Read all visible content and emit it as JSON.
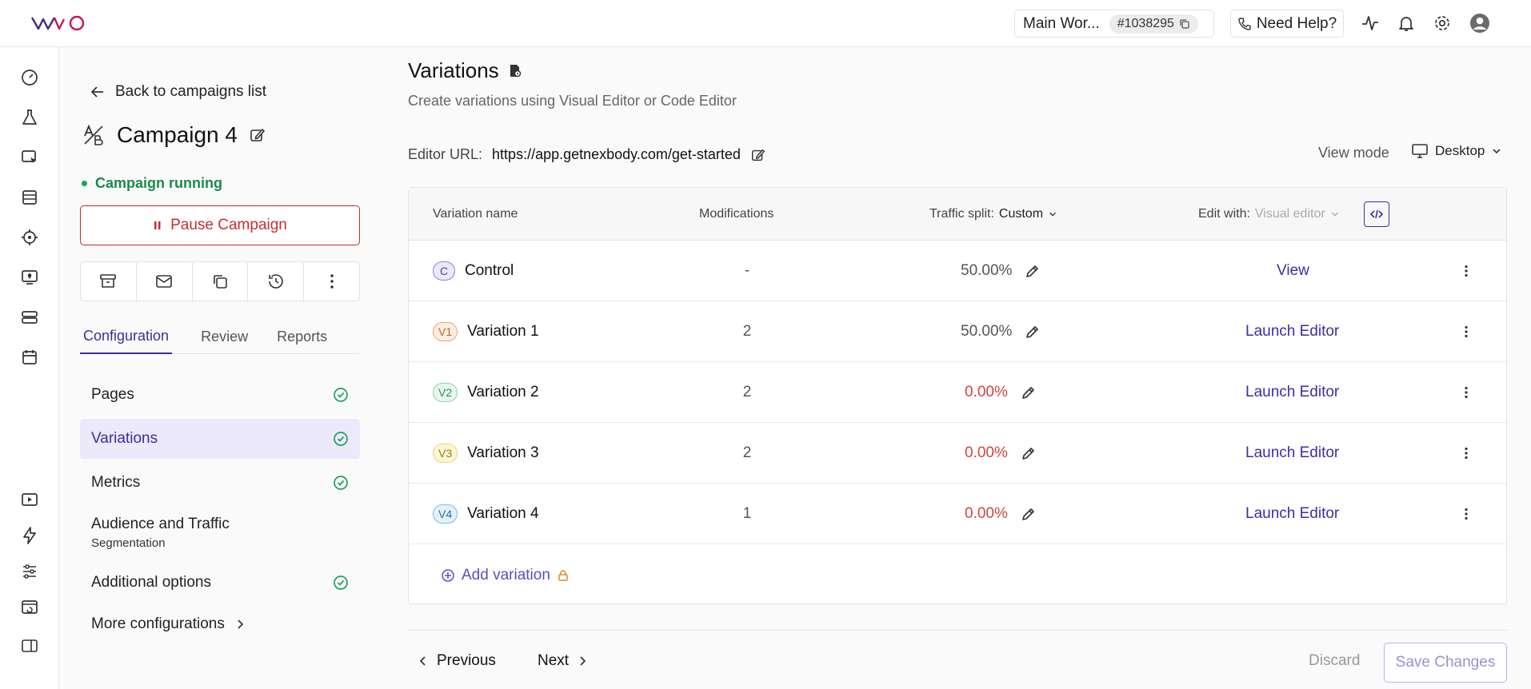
{
  "topbar": {
    "logo_text": "VWO",
    "workspace_name": "Main Wor...",
    "workspace_id": "#1038295",
    "help_label": "Need Help?"
  },
  "panel": {
    "back_label": "Back to campaigns list",
    "campaign_name": "Campaign 4",
    "status": "Campaign running",
    "pause_label": "Pause Campaign",
    "tabs": [
      "Configuration",
      "Review",
      "Reports"
    ],
    "nav": [
      {
        "label": "Pages",
        "sub": "",
        "done": true
      },
      {
        "label": "Variations",
        "sub": "",
        "done": true
      },
      {
        "label": "Metrics",
        "sub": "",
        "done": true
      },
      {
        "label": "Audience and Traffic",
        "sub": "Segmentation",
        "done": false
      },
      {
        "label": "Additional options",
        "sub": "",
        "done": true
      },
      {
        "label": "More configurations",
        "sub": "",
        "done": false
      }
    ]
  },
  "main": {
    "title": "Variations",
    "subtitle": "Create variations using Visual Editor or Code Editor",
    "editor_url_label": "Editor URL:",
    "editor_url": "https://app.getnexbody.com/get-started",
    "view_mode_label": "View mode",
    "device": "Desktop",
    "columns": {
      "name": "Variation name",
      "mods": "Modifications",
      "split_label": "Traffic split:",
      "split_value": "Custom",
      "edit_label": "Edit with:",
      "edit_value": "Visual editor"
    },
    "rows": [
      {
        "badge": "C",
        "name": "Control",
        "mods": "-",
        "split": "50.00%",
        "action": "View",
        "badge_bg": "#ece8fb",
        "badge_border": "#8e80d9",
        "badge_color": "#4b3fb0",
        "split_color": "#555555"
      },
      {
        "badge": "V1",
        "name": "Variation 1",
        "mods": "2",
        "split": "50.00%",
        "action": "Launch Editor",
        "badge_bg": "#fdeee2",
        "badge_border": "#f0a06a",
        "badge_color": "#c2602a",
        "split_color": "#555555"
      },
      {
        "badge": "V2",
        "name": "Variation 2",
        "mods": "2",
        "split": "0.00%",
        "action": "Launch Editor",
        "badge_bg": "#e7f7ee",
        "badge_border": "#8fd3ac",
        "badge_color": "#2c8f57",
        "split_color": "#d0453e"
      },
      {
        "badge": "V3",
        "name": "Variation 3",
        "mods": "2",
        "split": "0.00%",
        "action": "Launch Editor",
        "badge_bg": "#fdf6d8",
        "badge_border": "#ecd46a",
        "badge_color": "#9b7d0d",
        "split_color": "#d0453e"
      },
      {
        "badge": "V4",
        "name": "Variation 4",
        "mods": "1",
        "split": "0.00%",
        "action": "Launch Editor",
        "badge_bg": "#e3f1fb",
        "badge_border": "#7fb9e3",
        "badge_color": "#2a6c9c",
        "split_color": "#d0453e"
      }
    ],
    "add_variation": "Add variation",
    "previous": "Previous",
    "next": "Next",
    "discard": "Discard",
    "save": "Save Changes"
  },
  "colors": {
    "brand": "#3b2f9e",
    "running": "#1a8a4a",
    "danger": "#c62f2f"
  }
}
